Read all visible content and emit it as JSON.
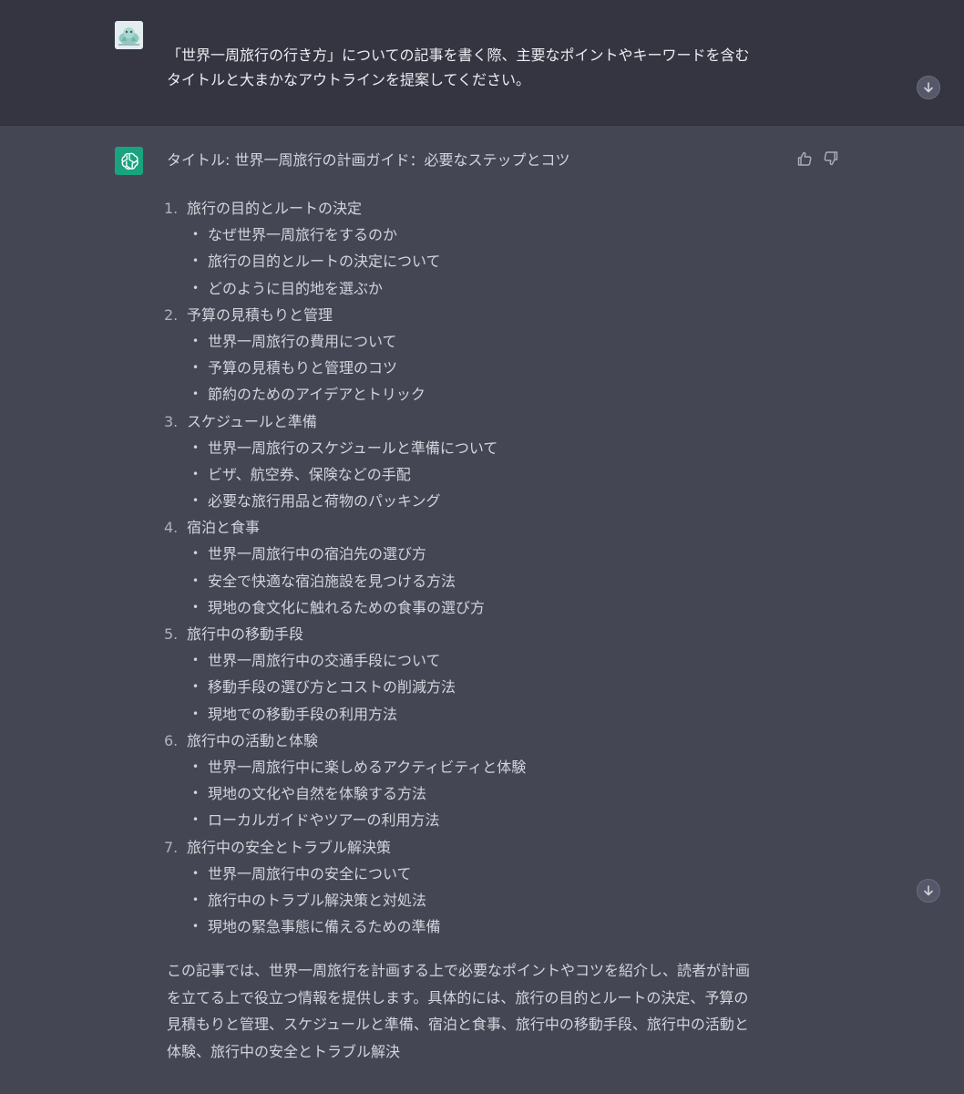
{
  "user_message": {
    "line1": "「世界一周旅行の行き方」についての記事を書く際、主要なポイントやキーワードを含む",
    "line2": "タイトルと大まかなアウトラインを提案してください。"
  },
  "assistant_message": {
    "title": "タイトル: 世界一周旅行の計画ガイド：必要なステップとコツ",
    "sections": [
      {
        "number": "1.",
        "label": "旅行の目的とルートの決定",
        "items": [
          "なぜ世界一周旅行をするのか",
          "旅行の目的とルートの決定について",
          "どのように目的地を選ぶか"
        ]
      },
      {
        "number": "2.",
        "label": "予算の見積もりと管理",
        "items": [
          "世界一周旅行の費用について",
          "予算の見積もりと管理のコツ",
          "節約のためのアイデアとトリック"
        ]
      },
      {
        "number": "3.",
        "label": "スケジュールと準備",
        "items": [
          "世界一周旅行のスケジュールと準備について",
          "ビザ、航空券、保険などの手配",
          "必要な旅行用品と荷物のパッキング"
        ]
      },
      {
        "number": "4.",
        "label": "宿泊と食事",
        "items": [
          "世界一周旅行中の宿泊先の選び方",
          "安全で快適な宿泊施設を見つける方法",
          "現地の食文化に触れるための食事の選び方"
        ]
      },
      {
        "number": "5.",
        "label": "旅行中の移動手段",
        "items": [
          "世界一周旅行中の交通手段について",
          "移動手段の選び方とコストの削減方法",
          "現地での移動手段の利用方法"
        ]
      },
      {
        "number": "6.",
        "label": "旅行中の活動と体験",
        "items": [
          "世界一周旅行中に楽しめるアクティビティと体験",
          "現地の文化や自然を体験する方法",
          "ローカルガイドやツアーの利用方法"
        ]
      },
      {
        "number": "7.",
        "label": "旅行中の安全とトラブル解決策",
        "items": [
          "世界一周旅行中の安全について",
          "旅行中のトラブル解決策と対処法",
          "現地の緊急事態に備えるための準備"
        ]
      }
    ],
    "summary_lines": [
      "この記事では、世界一周旅行を計画する上で必要なポイントやコツを紹介し、読者が計画",
      "を立てる上で役立つ情報を提供します。具体的には、旅行の目的とルートの決定、予算の",
      "見積もりと管理、スケジュールと準備、宿泊と食事、旅行中の移動手段、旅行中の活動と",
      "体験、旅行中の安全とトラブル解決"
    ]
  },
  "icons": {
    "user_avatar": "user-avatar-icon",
    "assistant_avatar": "openai-logo-icon",
    "thumbs_up": "thumbs-up-icon",
    "thumbs_down": "thumbs-down-icon",
    "scroll_down": "arrow-down-icon"
  },
  "colors": {
    "user_bg": "#343541",
    "assistant_bg": "#444654",
    "assistant_avatar_bg": "#19a37f",
    "text": "#d1d5db"
  }
}
